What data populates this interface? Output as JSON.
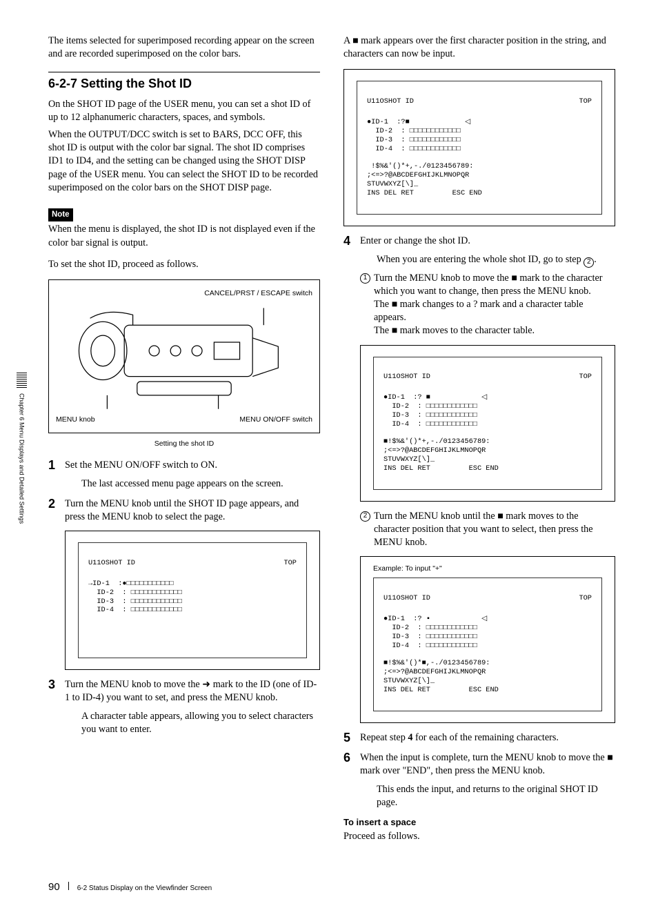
{
  "sidebar": {
    "chapter": "Chapter 6  Menu Displays and Detailed Settings"
  },
  "intro": "The items selected for superimposed recording appear on the screen and are recorded superimposed on the color bars.",
  "heading": "6-2-7  Setting the Shot ID",
  "para1": "On the SHOT ID page of the USER menu, you can set a shot ID of up to 12 alphanumeric characters, spaces, and symbols.",
  "para2": "When the OUTPUT/DCC switch is set to BARS, DCC OFF, this shot ID is output with the color bar signal. The shot ID comprises ID1 to ID4, and the setting can be changed using the SHOT DISP page of the USER menu. You can select the SHOT ID to be recorded superimposed on the color bars on the SHOT DISP page.",
  "noteLabel": "Note",
  "noteText": "When the menu is displayed, the shot ID is not displayed even if the color bar signal is output.",
  "proceed": "To set the shot ID, proceed as follows.",
  "fig": {
    "lab1": "CANCEL/PRST / ESCAPE switch",
    "lab2": "MENU knob",
    "lab3": "MENU ON/OFF switch",
    "caption": "Setting the shot ID"
  },
  "step1a": "Set the MENU ON/OFF switch to ON.",
  "step1b": "The last accessed menu page appears on the screen.",
  "step2": "Turn the MENU knob until the SHOT ID page appears, and press the MENU knob to select the page.",
  "screenA": {
    "title": "U11OSHOT ID",
    "top": "TOP",
    "l1": "→ID-1  :●□□□□□□□□□□□",
    "l2": "  ID-2  : □□□□□□□□□□□□",
    "l3": "  ID-3  : □□□□□□□□□□□□",
    "l4": "  ID-4  : □□□□□□□□□□□□"
  },
  "step3a": "Turn the MENU knob to move the ➜ mark to the ID (one of ID-1 to ID-4) you want to set, and press the MENU knob.",
  "step3b": "A character table appears, allowing you to select characters you want to enter.",
  "rightTop": "A ■ mark appears over the first character position in the string, and characters can now be input.",
  "screenB": {
    "title": "U11OSHOT ID",
    "top": "TOP",
    "l1": "●ID-1  :?■             ◁",
    "l2": "  ID-2  : □□□□□□□□□□□□",
    "l3": "  ID-3  : □□□□□□□□□□□□",
    "l4": "  ID-4  : □□□□□□□□□□□□",
    "c1": " !$%&'()*+,-./0123456789:",
    "c2": ";<=>?@ABCDEFGHIJKLMNOPQR",
    "c3": "STUVWXYZ[\\]_",
    "c4": "INS DEL RET         ESC END"
  },
  "step4a": "Enter or change the shot ID.",
  "step4b": "When you are entering the whole shot ID, go to step ",
  "step4b_num": "2",
  "sub1a": "Turn the MENU knob to move the ■ mark to the character which you want to change, then press the MENU knob.",
  "sub1b": "The ■ mark changes to a ? mark and a character table appears.",
  "sub1c": "The ■ mark moves to the character table.",
  "screenC": {
    "title": "U11OSHOT ID",
    "top": "TOP",
    "l1": "●ID-1  :? ■            ◁",
    "l2": "  ID-2  : □□□□□□□□□□□□",
    "l3": "  ID-3  : □□□□□□□□□□□□",
    "l4": "  ID-4  : □□□□□□□□□□□□",
    "c1": "■!$%&'()*+,-./0123456789:",
    "c2": ";<=>?@ABCDEFGHIJKLMNOPQR",
    "c3": "STUVWXYZ[\\]_",
    "c4": "INS DEL RET         ESC END"
  },
  "sub2": "Turn the MENU knob until the ■ mark moves to the character position that you want to select, then press the MENU knob.",
  "exampleLabel": "Example: To input \"+\"",
  "screenD": {
    "title": "U11OSHOT ID",
    "top": "TOP",
    "l1": "●ID-1  :? ▪            ◁",
    "l2": "  ID-2  : □□□□□□□□□□□□",
    "l3": "  ID-3  : □□□□□□□□□□□□",
    "l4": "  ID-4  : □□□□□□□□□□□□",
    "c1": "■!$%&'()*■,-./0123456789:",
    "c2": ";<=>?@ABCDEFGHIJKLMNOPQR",
    "c3": "STUVWXYZ[\\]_",
    "c4": "INS DEL RET         ESC END"
  },
  "step5": "Repeat step 4 for each of the remaining characters.",
  "step6a": "When the input is complete, turn the MENU knob to move the ■ mark over \"END\", then press the MENU knob.",
  "step6b": "This ends the input, and returns to the original SHOT ID page.",
  "insertHead": "To insert a space",
  "insertText": "Proceed as follows.",
  "footer": {
    "page": "90",
    "section": "6-2 Status Display on the Viewfinder Screen"
  }
}
